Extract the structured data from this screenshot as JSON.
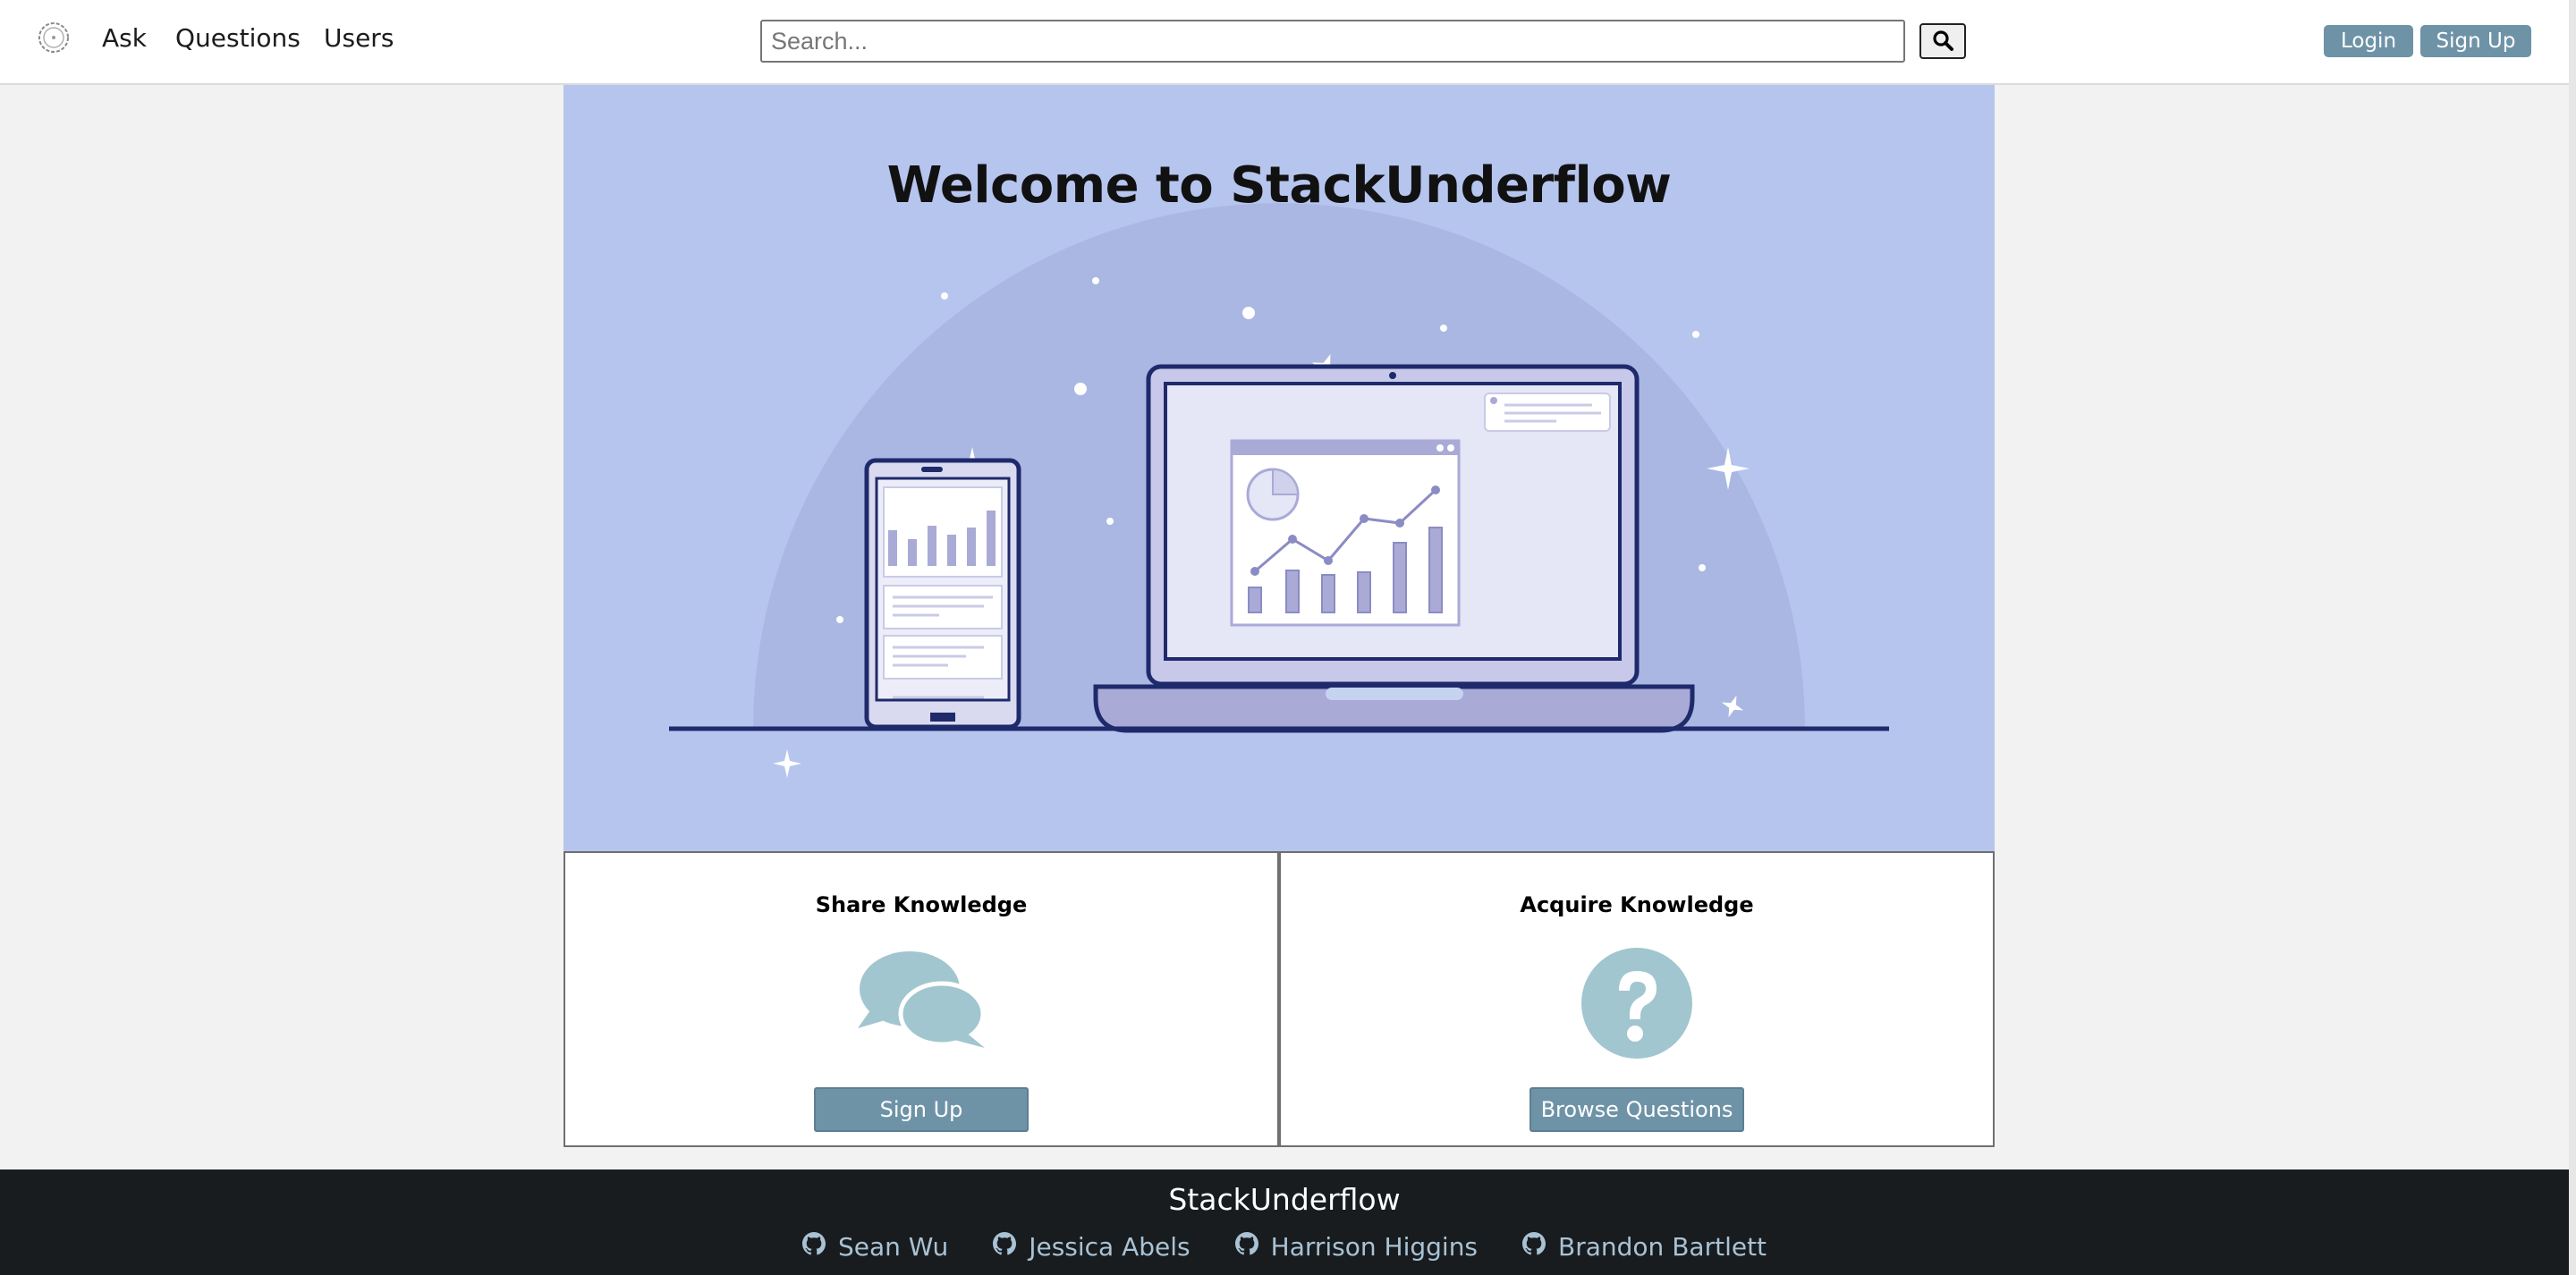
{
  "nav": {
    "links": [
      {
        "label": "Ask"
      },
      {
        "label": "Questions"
      },
      {
        "label": "Users"
      }
    ],
    "search_placeholder": "Search...",
    "login_label": "Login",
    "signup_label": "Sign Up",
    "logo_icon": "sun-logo-icon",
    "search_icon": "magnifier-icon"
  },
  "hero": {
    "title": "Welcome to StackUnderflow"
  },
  "cards": [
    {
      "title": "Share Knowledge",
      "icon": "chat-bubbles-icon",
      "button_label": "Sign Up"
    },
    {
      "title": "Acquire Knowledge",
      "icon": "question-circle-icon",
      "button_label": "Browse Questions"
    }
  ],
  "footer": {
    "title": "StackUnderflow",
    "contributors": [
      {
        "name": "Sean Wu",
        "icon": "github-icon"
      },
      {
        "name": "Jessica Abels",
        "icon": "github-icon"
      },
      {
        "name": "Harrison Higgins",
        "icon": "github-icon"
      },
      {
        "name": "Brandon Bartlett",
        "icon": "github-icon"
      }
    ]
  },
  "colors": {
    "hero_bg": "#b6c5ee",
    "button": "#6e93a7",
    "icon_teal": "#a1c6cf",
    "footer_bg": "#181c1f",
    "footer_link": "#a9c2d4",
    "illustration_navy": "#1e2a6b",
    "illustration_lavender": "#a9aad6"
  }
}
